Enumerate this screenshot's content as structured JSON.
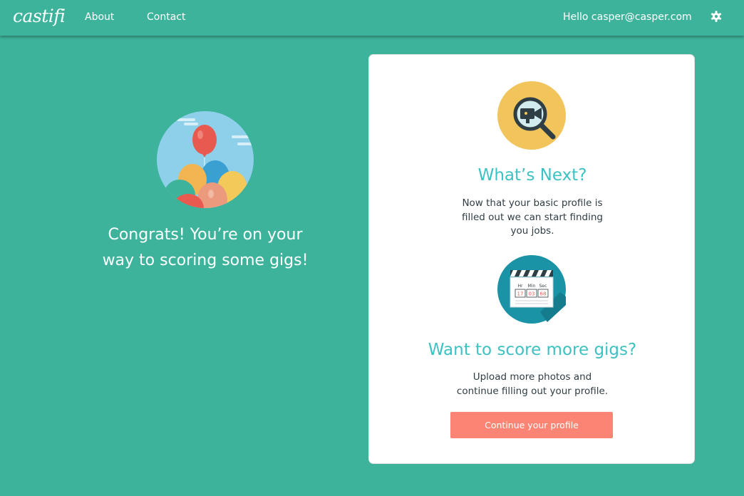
{
  "nav": {
    "logo": "castifi",
    "links": [
      "About",
      "Contact"
    ],
    "greeting": "Hello casper@casper.com",
    "settings_icon": "gear-icon"
  },
  "hero": {
    "image_icon": "balloons-illustration",
    "message": "Congrats! You’re on your way to scoring some gigs!"
  },
  "card": {
    "sections": [
      {
        "icon": "camera-search-icon",
        "title": "What’s Next?",
        "lines": [
          "Now that your basic profile is",
          "filled out we can start finding",
          "you jobs."
        ]
      },
      {
        "icon": "clapperboard-timer-icon",
        "title": "Want to score more gigs?",
        "lines": [
          "Upload more photos and",
          "continue filling out your profile."
        ],
        "clapper_labels": [
          "Hr",
          "Min",
          "Sec"
        ],
        "clapper_values": [
          "17",
          "03",
          "68"
        ]
      }
    ],
    "button_label": "Continue your profile"
  },
  "colors": {
    "background": "#3db39b",
    "heading": "#3ec1c3",
    "button": "#fc8474",
    "card": "#ffffff"
  }
}
